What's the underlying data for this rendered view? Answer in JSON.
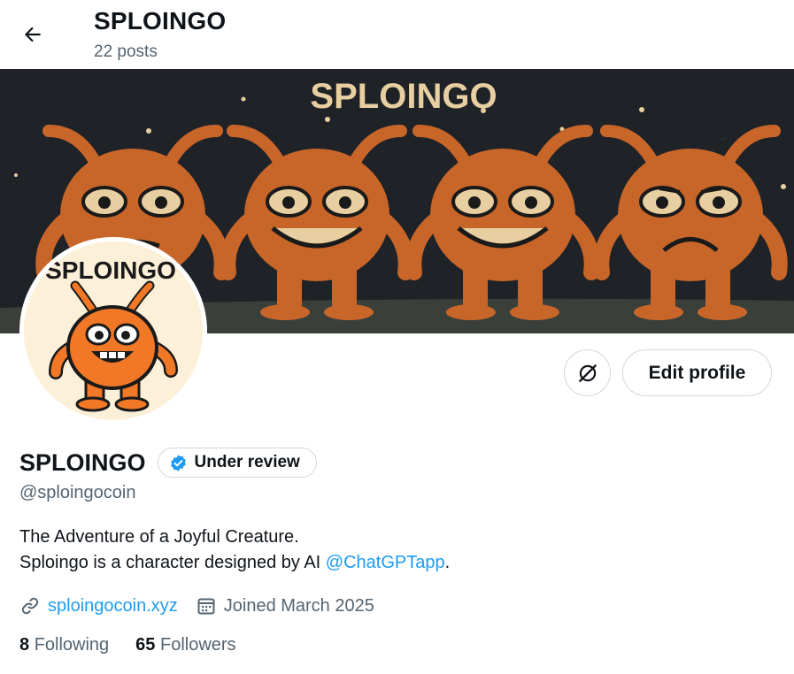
{
  "header": {
    "back_icon": "arrow-left-icon",
    "title": "SPLOINGO",
    "posts_count": "22 posts"
  },
  "banner": {
    "text": "SPLOINGO",
    "background": "#1f2226",
    "creature_color": "#c8662a",
    "text_color": "#e8cfa2"
  },
  "avatar": {
    "text": "SPLOINGO",
    "background": "#fdf0d9",
    "creature_color": "#f07826"
  },
  "actions": {
    "icon_button": "no-signal-icon",
    "edit_label": "Edit profile"
  },
  "profile": {
    "name": "SPLOINGO",
    "badge_label": "Under review",
    "badge_icon": "verified-check-icon",
    "handle": "@sploingocoin",
    "bio_line1": "The Adventure of a Joyful Creature.",
    "bio_line2_prefix": "Sploingo is a character designed by AI ",
    "bio_mention": "@ChatGPTapp",
    "bio_line2_suffix": ".",
    "website": "sploingocoin.xyz",
    "website_icon": "link-icon",
    "joined": "Joined March 2025",
    "joined_icon": "calendar-icon"
  },
  "stats": {
    "following_count": "8",
    "following_label": "Following",
    "followers_count": "65",
    "followers_label": "Followers"
  },
  "colors": {
    "accent": "#1d9bf0",
    "secondary_text": "#536471",
    "border": "#cfd9de"
  }
}
